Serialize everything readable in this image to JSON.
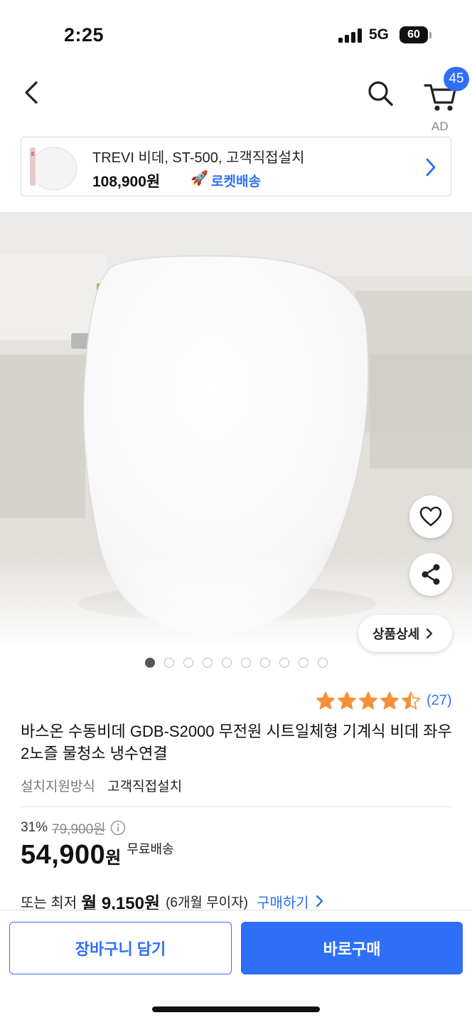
{
  "status_bar": {
    "time": "2:25",
    "network": "5G",
    "battery": "60"
  },
  "nav": {
    "cart_count": "45"
  },
  "ad": {
    "label": "AD",
    "title": "TREVI 비데, ST-500, 고객직접설치",
    "price": "108,900원",
    "delivery": "로켓배송"
  },
  "hero": {
    "detail_label": "상품상세",
    "page_count": 10,
    "active_page": 1
  },
  "product": {
    "rating": 4.5,
    "rating_count": "(27)",
    "title": "바스온 수동비데 GDB-S2000 무전원 시트일체형 기계식 비데 좌우2노즐 물청소 냉수연결",
    "install_label": "설치지원방식",
    "install_value": "고객직접설치",
    "discount_rate": "31%",
    "original_price": "79,900원",
    "sale_price": "54,900",
    "price_unit": "원",
    "shipping": "무료배송",
    "installment_prefix": "또는 최저",
    "installment_amount": "월 9,150원",
    "installment_months": "(6개월 무이자)",
    "installment_link": "구매하기"
  },
  "actions": {
    "add_to_cart": "장바구니 담기",
    "buy_now": "바로구매"
  },
  "colors": {
    "accent": "#2f6ff7",
    "star": "#f5903a"
  }
}
